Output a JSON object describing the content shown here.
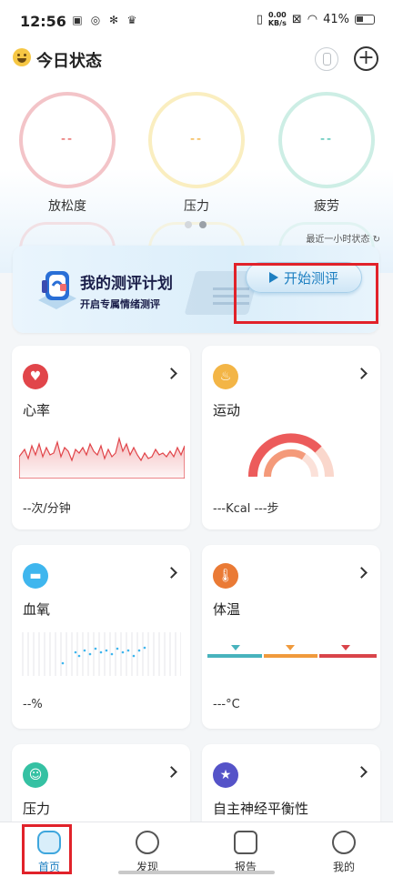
{
  "status_bar": {
    "time": "12:56",
    "speed_value": "0.00",
    "speed_unit": "KB/s",
    "battery": "41%"
  },
  "header": {
    "title": "今日状态"
  },
  "rings": [
    {
      "label": "放松度",
      "value": "--",
      "color": "#f3c4c8",
      "value_color": "#e0413f"
    },
    {
      "label": "压力",
      "value": "--",
      "color": "#faeec0",
      "value_color": "#f0a21c"
    },
    {
      "label": "疲劳",
      "value": "--",
      "color": "#cdeee5",
      "value_color": "#25b3a1"
    }
  ],
  "carousel": {
    "recent_label": "最近一小时状态",
    "page_count": 2,
    "active_page": 2
  },
  "plan_card": {
    "title": "我的测评计划",
    "subtitle": "开启专属情绪测评",
    "button_label": "开始测评"
  },
  "metrics": {
    "heart_rate": {
      "title": "心率",
      "value": "--次/分钟",
      "color": "#e1454a"
    },
    "exercise": {
      "title": "运动",
      "value": "---Kcal ---步",
      "color": "#f3b546",
      "ring_progress": 0.75
    },
    "blood_oxygen": {
      "title": "血氧",
      "value": "--%",
      "color": "#3fb6ee"
    },
    "temperature": {
      "title": "体温",
      "value": "---°C",
      "color": "#ea7a35"
    },
    "stress": {
      "title": "压力",
      "color": "#35c1a3"
    },
    "ans_balance": {
      "title": "自主神经平衡性",
      "color": "#5553c8"
    }
  },
  "bottom_nav": [
    {
      "label": "首页",
      "icon": "home-icon",
      "active": true
    },
    {
      "label": "发现",
      "icon": "compass-icon",
      "active": false
    },
    {
      "label": "报告",
      "icon": "report-icon",
      "active": false
    },
    {
      "label": "我的",
      "icon": "profile-icon",
      "active": false
    }
  ]
}
